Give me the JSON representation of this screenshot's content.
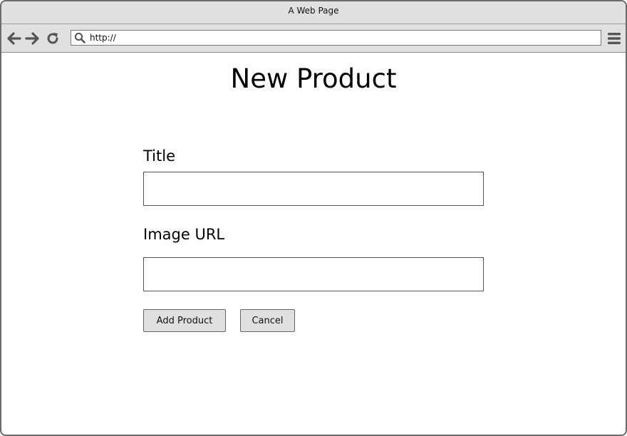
{
  "window": {
    "title": "A Web Page"
  },
  "toolbar": {
    "back_icon": "arrow-left-icon",
    "forward_icon": "arrow-right-icon",
    "reload_icon": "reload-icon",
    "search_icon": "search-icon",
    "address_value": "http://",
    "menu_icon": "hamburger-menu-icon"
  },
  "page": {
    "heading": "New Product",
    "form": {
      "title_label": "Title",
      "title_value": "",
      "image_url_label": "Image URL",
      "image_url_value": "",
      "add_button_label": "Add Product",
      "cancel_button_label": "Cancel"
    }
  },
  "colors": {
    "chrome_background": "#e0e0e0",
    "border": "#6b6b6b",
    "icon": "#555555",
    "text": "#000000"
  }
}
